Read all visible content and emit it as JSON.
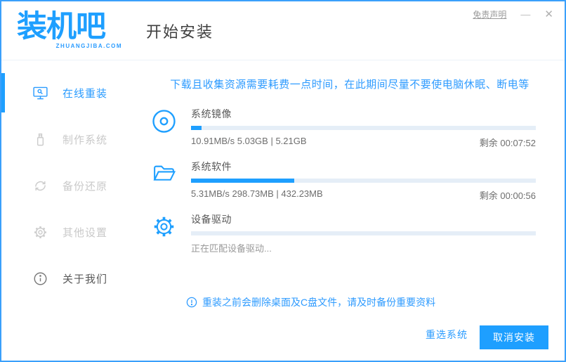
{
  "colors": {
    "primary": "#1e9fff",
    "accent_text": "#2b9cff",
    "window_border": "#3aa0fb",
    "progress_track": "#e5eef7",
    "disabled_gray": "#c9c9c9"
  },
  "window": {
    "disclaimer": "免责声明",
    "minimize": "—",
    "close": "✕"
  },
  "header": {
    "logo_text": "装机吧",
    "logo_sub": "ZHUANGJIBA.COM",
    "page_title": "开始安装"
  },
  "sidebar": {
    "items": [
      {
        "label": "在线重装",
        "icon": "monitor-icon",
        "active": true
      },
      {
        "label": "制作系统",
        "icon": "usb-icon",
        "active": false
      },
      {
        "label": "备份还原",
        "icon": "restore-icon",
        "active": false
      },
      {
        "label": "其他设置",
        "icon": "settings-icon",
        "active": false
      },
      {
        "label": "关于我们",
        "icon": "about-icon",
        "active": false
      }
    ]
  },
  "main": {
    "notice": "下载且收集资源需要耗费一点时间，在此期间尽量不要使电脑休眠、断电等",
    "tasks": [
      {
        "name": "系统镜像",
        "icon": "disc-icon",
        "progress_percent": 3,
        "stats": "10.91MB/s 5.03GB | 5.21GB",
        "remaining": "剩余 00:07:52"
      },
      {
        "name": "系统软件",
        "icon": "folder-icon",
        "progress_percent": 30,
        "stats": "5.31MB/s 298.73MB | 432.23MB",
        "remaining": "剩余 00:00:56"
      },
      {
        "name": "设备驱动",
        "icon": "gear-icon",
        "progress_percent": 0,
        "status": "正在匹配设备驱动..."
      }
    ],
    "warning_note": "重装之前会删除桌面及C盘文件，请及时备份重要资料"
  },
  "footer": {
    "reselect_label": "重选系统",
    "cancel_label": "取消安装"
  }
}
